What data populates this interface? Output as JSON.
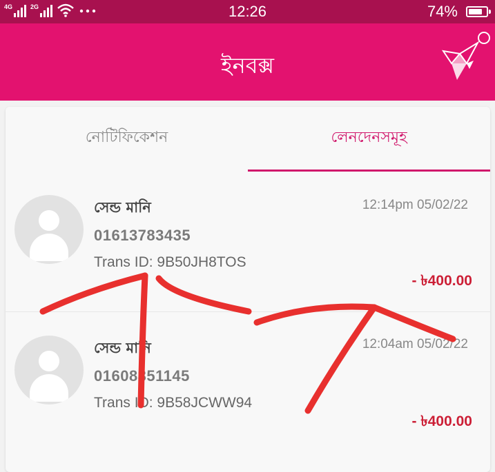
{
  "status_bar": {
    "net1_label": "4G",
    "net2_label": "2G",
    "time": "12:26",
    "battery": "74%",
    "battery_level": 0.74
  },
  "app_bar": {
    "title": "ইনবক্স"
  },
  "tabs": [
    {
      "label": "নোটিফিকেশন",
      "active": false
    },
    {
      "label": "লেনদেনসমূহ",
      "active": true
    }
  ],
  "transactions": [
    {
      "title": "সেন্ড মানি",
      "number": "01613783435",
      "trans_id": "Trans ID: 9B50JH8TOS",
      "datetime": "12:14pm 05/02/22",
      "amount": "- ৳400.00"
    },
    {
      "title": "সেন্ড মানি",
      "number": "01608351145",
      "trans_id": "Trans ID: 9B58JCWW94",
      "datetime": "12:04am 05/02/22",
      "amount": "- ৳400.00"
    }
  ],
  "colors": {
    "status_bar": "#a8114f",
    "app_bar": "#e3126f",
    "accent": "#d0176b",
    "amount": "#cc1f36",
    "annotation": "#e8302e"
  }
}
